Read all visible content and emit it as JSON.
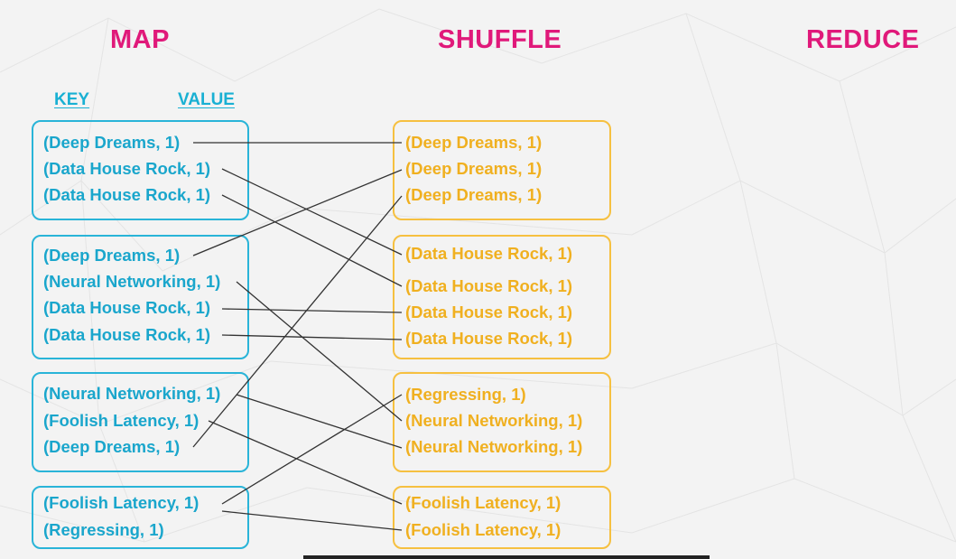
{
  "headings": {
    "map": "MAP",
    "shuffle": "SHUFFLE",
    "reduce": "REDUCE"
  },
  "subheadings": {
    "key": "KEY",
    "value": "VALUE"
  },
  "map_groups": [
    [
      "(Deep Dreams, 1)",
      "(Data House Rock, 1)",
      "(Data House Rock, 1)"
    ],
    [
      "(Deep Dreams, 1)",
      "(Neural Networking, 1)",
      "(Data House Rock, 1)",
      "(Data House Rock, 1)"
    ],
    [
      "(Neural Networking, 1)",
      "(Foolish Latency, 1)",
      "(Deep Dreams, 1)"
    ],
    [
      "(Foolish Latency, 1)",
      "(Regressing, 1)"
    ]
  ],
  "shuffle_groups": [
    [
      "(Deep Dreams, 1)",
      "(Deep Dreams, 1)",
      "(Deep Dreams, 1)"
    ],
    [
      "(Data House Rock, 1)",
      "(Data House Rock, 1)",
      "(Data House Rock, 1)",
      "(Data House Rock, 1)"
    ],
    [
      "(Regressing, 1)",
      "(Neural Networking, 1)",
      "(Neural Networking, 1)"
    ],
    [
      "(Foolish Latency, 1)",
      "(Foolish Latency, 1)"
    ]
  ],
  "colors": {
    "map": "#1aa6cc",
    "shuffle": "#f0b020",
    "heading": "#e0197a",
    "connector": "#333333"
  }
}
